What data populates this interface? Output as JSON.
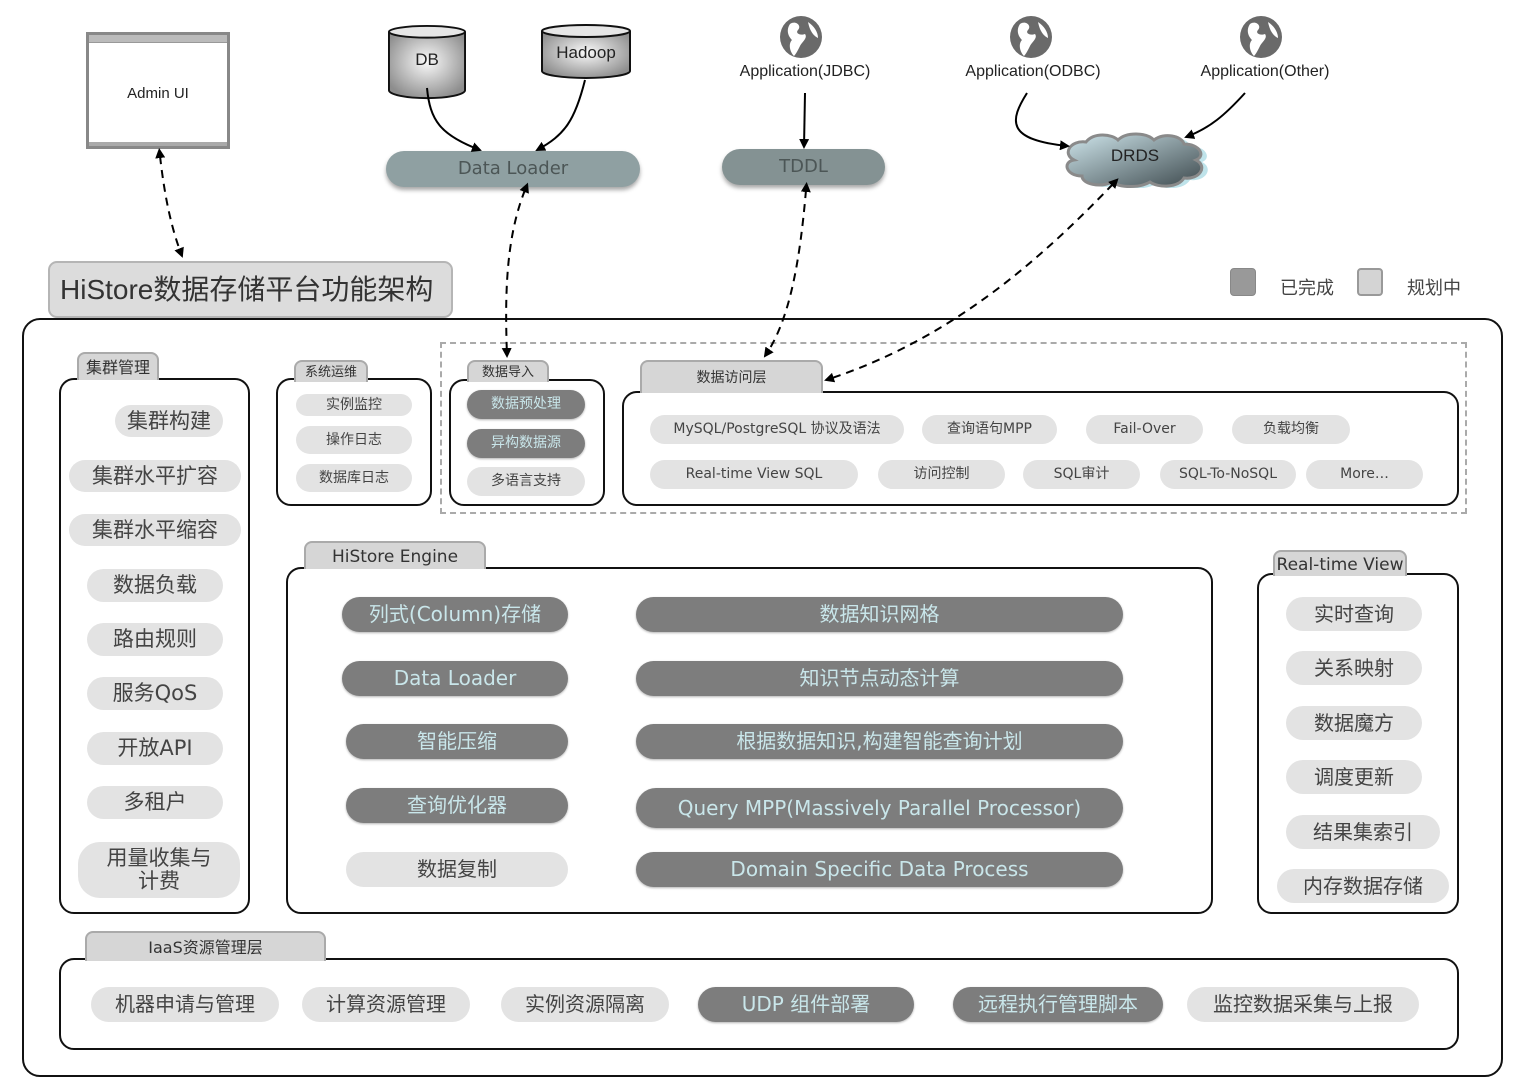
{
  "title": "HiStore数据存储平台功能架构",
  "colors": {
    "done": "#7d7d7d",
    "done_text": "#c9e6ea",
    "planned": "#e3e3e3",
    "planned_text": "#444444",
    "node_pill": "#8fa0a2"
  },
  "legend": [
    {
      "label": "已完成",
      "status": "done"
    },
    {
      "label": "规划中",
      "status": "planned"
    }
  ],
  "external": {
    "admin_ui": {
      "label": "Admin UI",
      "icon": "browser-window-icon"
    },
    "databases": [
      {
        "label": "DB",
        "icon": "database-cylinder-icon"
      },
      {
        "label": "Hadoop",
        "icon": "database-cylinder-icon"
      }
    ],
    "data_loader": "Data Loader",
    "tddl": "TDDL",
    "drds": "DRDS",
    "applications": [
      {
        "label": "Application(JDBC)",
        "icon": "globe-icon"
      },
      {
        "label": "Application(ODBC)",
        "icon": "globe-icon"
      },
      {
        "label": "Application(Other)",
        "icon": "globe-icon"
      }
    ]
  },
  "groups": {
    "cluster": {
      "title": "集群管理",
      "items": [
        {
          "label": "集群构建",
          "status": "planned"
        },
        {
          "label": "集群水平扩容",
          "status": "planned"
        },
        {
          "label": "集群水平缩容",
          "status": "planned"
        },
        {
          "label": "数据负载",
          "status": "planned"
        },
        {
          "label": "路由规则",
          "status": "planned"
        },
        {
          "label": "服务QoS",
          "status": "planned"
        },
        {
          "label": "开放API",
          "status": "planned"
        },
        {
          "label": "多租户",
          "status": "planned"
        },
        {
          "label": "用量收集与计费",
          "status": "planned"
        }
      ]
    },
    "ops": {
      "title": "系统运维",
      "items": [
        {
          "label": "实例监控",
          "status": "planned"
        },
        {
          "label": "操作日志",
          "status": "planned"
        },
        {
          "label": "数据库日志",
          "status": "planned"
        }
      ]
    },
    "import": {
      "title": "数据导入",
      "items": [
        {
          "label": "数据预处理",
          "status": "done"
        },
        {
          "label": "异构数据源",
          "status": "done"
        },
        {
          "label": "多语言支持",
          "status": "planned"
        }
      ]
    },
    "access": {
      "title": "数据访问层",
      "items": [
        {
          "label": "MySQL/PostgreSQL  协议及语法",
          "status": "planned"
        },
        {
          "label": "查询语句MPP",
          "status": "planned"
        },
        {
          "label": "Fail-Over",
          "status": "planned"
        },
        {
          "label": "负载均衡",
          "status": "planned"
        },
        {
          "label": "Real-time View SQL",
          "status": "planned"
        },
        {
          "label": "访问控制",
          "status": "planned"
        },
        {
          "label": "SQL审计",
          "status": "planned"
        },
        {
          "label": "SQL-To-NoSQL",
          "status": "planned"
        },
        {
          "label": "More…",
          "status": "planned"
        }
      ]
    },
    "engine": {
      "title": "HiStore Engine",
      "items": [
        {
          "label": "列式(Column)存储",
          "status": "done"
        },
        {
          "label": "数据知识网格",
          "status": "done"
        },
        {
          "label": "Data Loader",
          "status": "done"
        },
        {
          "label": "知识节点动态计算",
          "status": "done"
        },
        {
          "label": "智能压缩",
          "status": "done"
        },
        {
          "label": "根据数据知识,构建智能查询计划",
          "status": "done"
        },
        {
          "label": "查询优化器",
          "status": "done"
        },
        {
          "label": "Query MPP(Massively Parallel Processor)",
          "status": "done"
        },
        {
          "label": "数据复制",
          "status": "planned"
        },
        {
          "label": "Domain Specific Data Process",
          "status": "done"
        }
      ]
    },
    "realtime": {
      "title": "Real-time View",
      "items": [
        {
          "label": "实时查询",
          "status": "planned"
        },
        {
          "label": "关系映射",
          "status": "planned"
        },
        {
          "label": "数据魔方",
          "status": "planned"
        },
        {
          "label": "调度更新",
          "status": "planned"
        },
        {
          "label": "结果集索引",
          "status": "planned"
        },
        {
          "label": "内存数据存储",
          "status": "planned"
        }
      ]
    },
    "iaas": {
      "title": "IaaS资源管理层",
      "items": [
        {
          "label": "机器申请与管理",
          "status": "planned"
        },
        {
          "label": "计算资源管理",
          "status": "planned"
        },
        {
          "label": "实例资源隔离",
          "status": "planned"
        },
        {
          "label": "UDP 组件部署",
          "status": "done"
        },
        {
          "label": "远程执行管理脚本",
          "status": "done"
        },
        {
          "label": "监控数据采集与上报",
          "status": "planned"
        }
      ]
    }
  }
}
